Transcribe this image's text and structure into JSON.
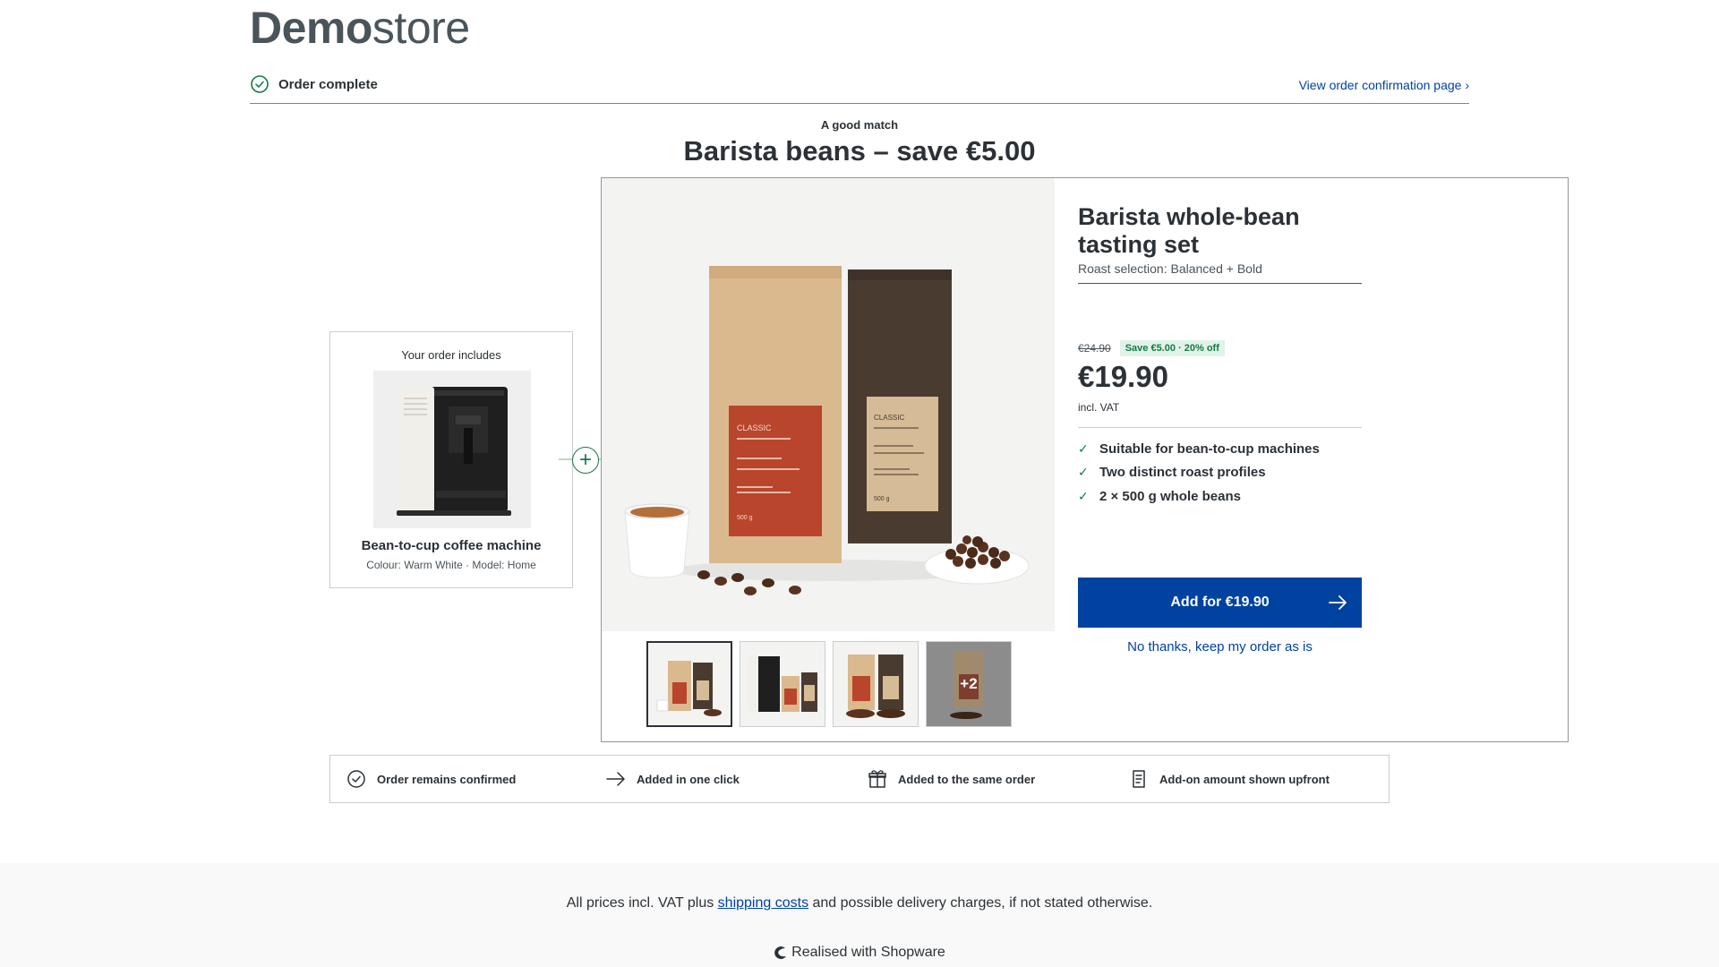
{
  "header": {
    "logo_bold": "Demo",
    "logo_regular": "store"
  },
  "status": {
    "label": "Order complete",
    "link": "View order confirmation page ›"
  },
  "offer": {
    "eyebrow": "A good match",
    "headline": "Barista beans – save €5.00"
  },
  "includes": {
    "title": "Your order includes",
    "name": "Bean-to-cup coffee machine",
    "meta": "Colour: Warm White · Model: Home"
  },
  "product": {
    "title": "Barista whole-bean tasting set",
    "variant": "Roast selection: Balanced + Bold",
    "old_price": "€24.90",
    "save_badge": "Save €5.00 · 20% off",
    "price": "€19.90",
    "vat": "incl. VAT",
    "features": [
      "Suitable for bean-to-cup machines",
      "Two distinct roast profiles",
      "2 × 500 g whole beans"
    ],
    "add_button": "Add for €19.90",
    "decline_link": "No thanks, keep my order as is",
    "bag_label_left": "CLASSIC",
    "bag_label_right": "CLASSIC",
    "bag_weight": "500 g",
    "thumbs_more": "+2"
  },
  "trust": [
    {
      "icon": "check-circle-icon",
      "label": "Order remains confirmed"
    },
    {
      "icon": "arrow-right-icon",
      "label": "Added in one click"
    },
    {
      "icon": "gift-icon",
      "label": "Added to the same order"
    },
    {
      "icon": "receipt-icon",
      "label": "Add-on amount shown upfront"
    }
  ],
  "footer": {
    "vat_prefix": "All prices incl. VAT plus ",
    "vat_link": "shipping costs",
    "vat_suffix": " and possible delivery charges, if not stated otherwise.",
    "powered": "Realised with Shopware"
  },
  "colors": {
    "primary": "#0042a0",
    "success": "#157a46",
    "text": "#2b3136"
  }
}
